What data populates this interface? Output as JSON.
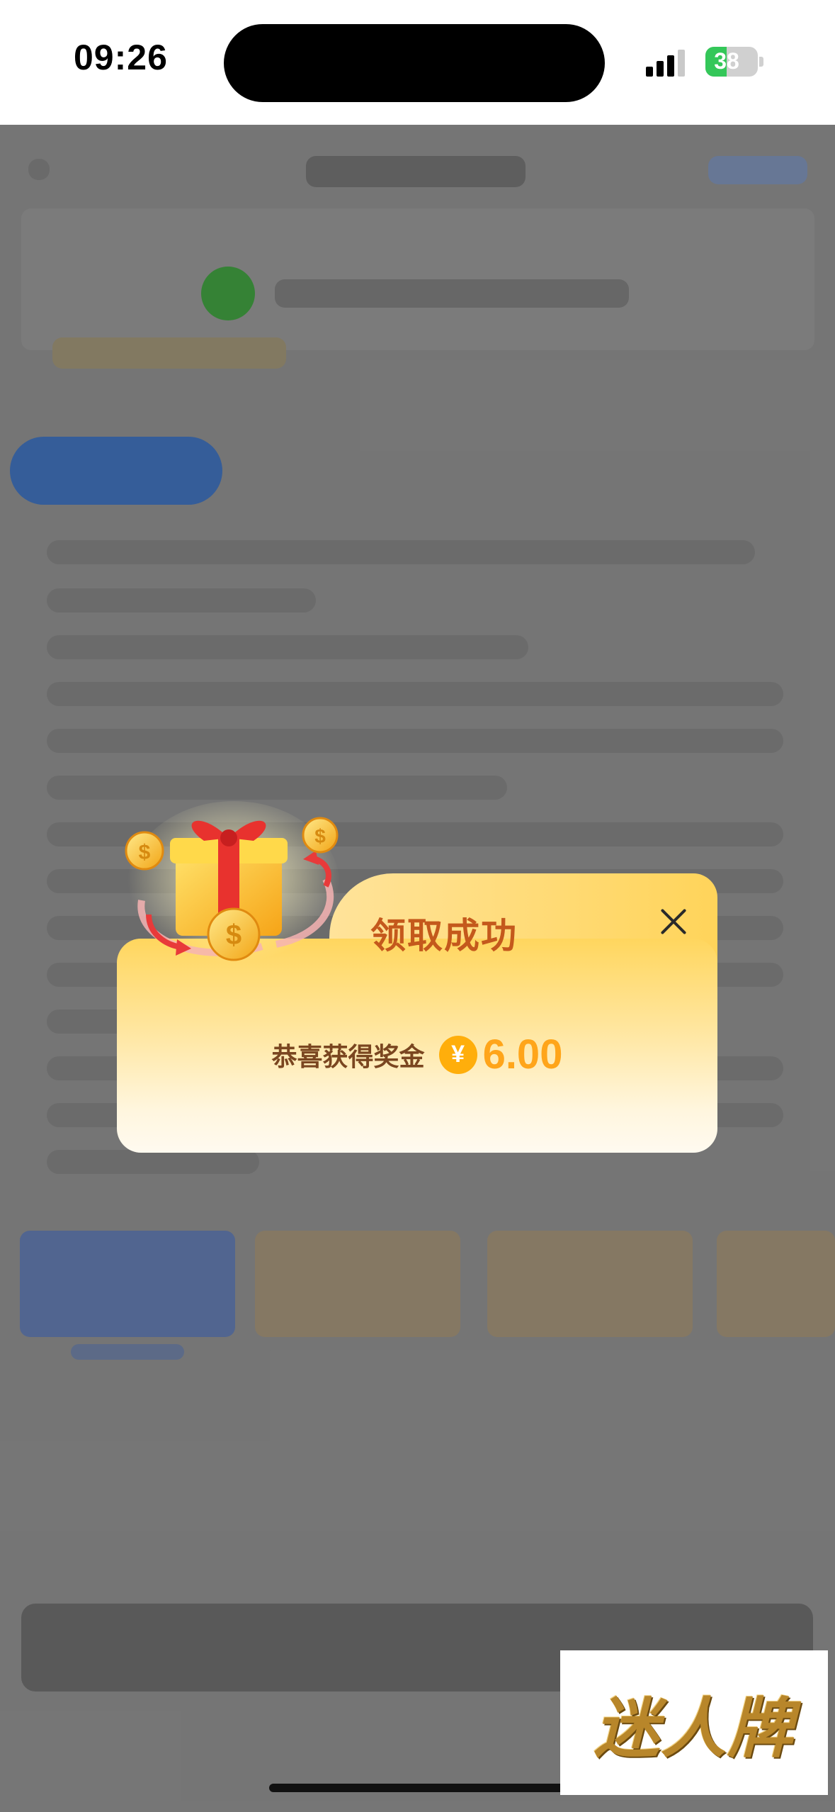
{
  "status_bar": {
    "time": "09:26",
    "battery": "38"
  },
  "modal": {
    "title": "领取成功",
    "prize_label": "恭喜获得奖金",
    "currency_symbol": "¥",
    "prize_amount": "6.00"
  },
  "watermark": {
    "text": "迷人牌"
  },
  "colors": {
    "title": "#c4591c",
    "amount": "#ffa51a",
    "card_top": "#ffd65e",
    "card_bottom": "#fffaf0",
    "battery_fill": "#34c759"
  },
  "icons": [
    "gift-icon",
    "coin-icon",
    "close-icon",
    "yen-icon"
  ]
}
